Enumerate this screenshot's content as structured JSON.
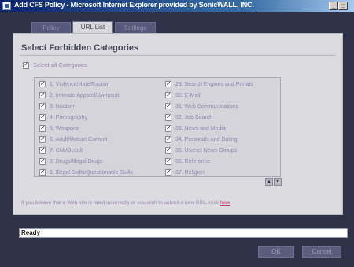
{
  "window": {
    "title": "Add CFS Policy - Microsoft Internet Explorer provided by SonicWALL, INC.",
    "minimize_glyph": "_",
    "maximize_glyph": "□"
  },
  "tabs": [
    {
      "label": "Policy",
      "active": false
    },
    {
      "label": "URL List",
      "active": true
    },
    {
      "label": "Settings",
      "active": false
    }
  ],
  "panel": {
    "title": "Select Forbidden Categories",
    "select_all_label": "Select all Categories",
    "categories_col1": [
      "1. Violence/Hate/Racism",
      "2. Intimate Apparel/Swimsuit",
      "3. Nudism",
      "4. Pornography",
      "5. Weapons",
      "6. Adult/Mature Content",
      "7. Cult/Occult",
      "8. Drugs/Illegal Drugs",
      "9. Illegal Skills/Questionable Skills"
    ],
    "categories_col2": [
      "29. Search Engines and Portals",
      "30. E-Mail",
      "31. Web Communications",
      "32. Job Search",
      "33. News and Media",
      "34. Personals and Dating",
      "35. Usenet News Groups",
      "36. Reference",
      "37. Religion"
    ],
    "scroll_up_glyph": "▲",
    "scroll_down_glyph": "▼",
    "footer_text": "If you believe that a Web site is rated incorrectly or you wish to submit a new URL, click ",
    "footer_link": "here"
  },
  "status": {
    "text": "Ready"
  },
  "buttons": {
    "ok": "OK",
    "cancel": "Cancel"
  },
  "colors": {
    "background": "#2e3148",
    "panel": "#dcdce0",
    "accent_link": "#c83a7a"
  }
}
